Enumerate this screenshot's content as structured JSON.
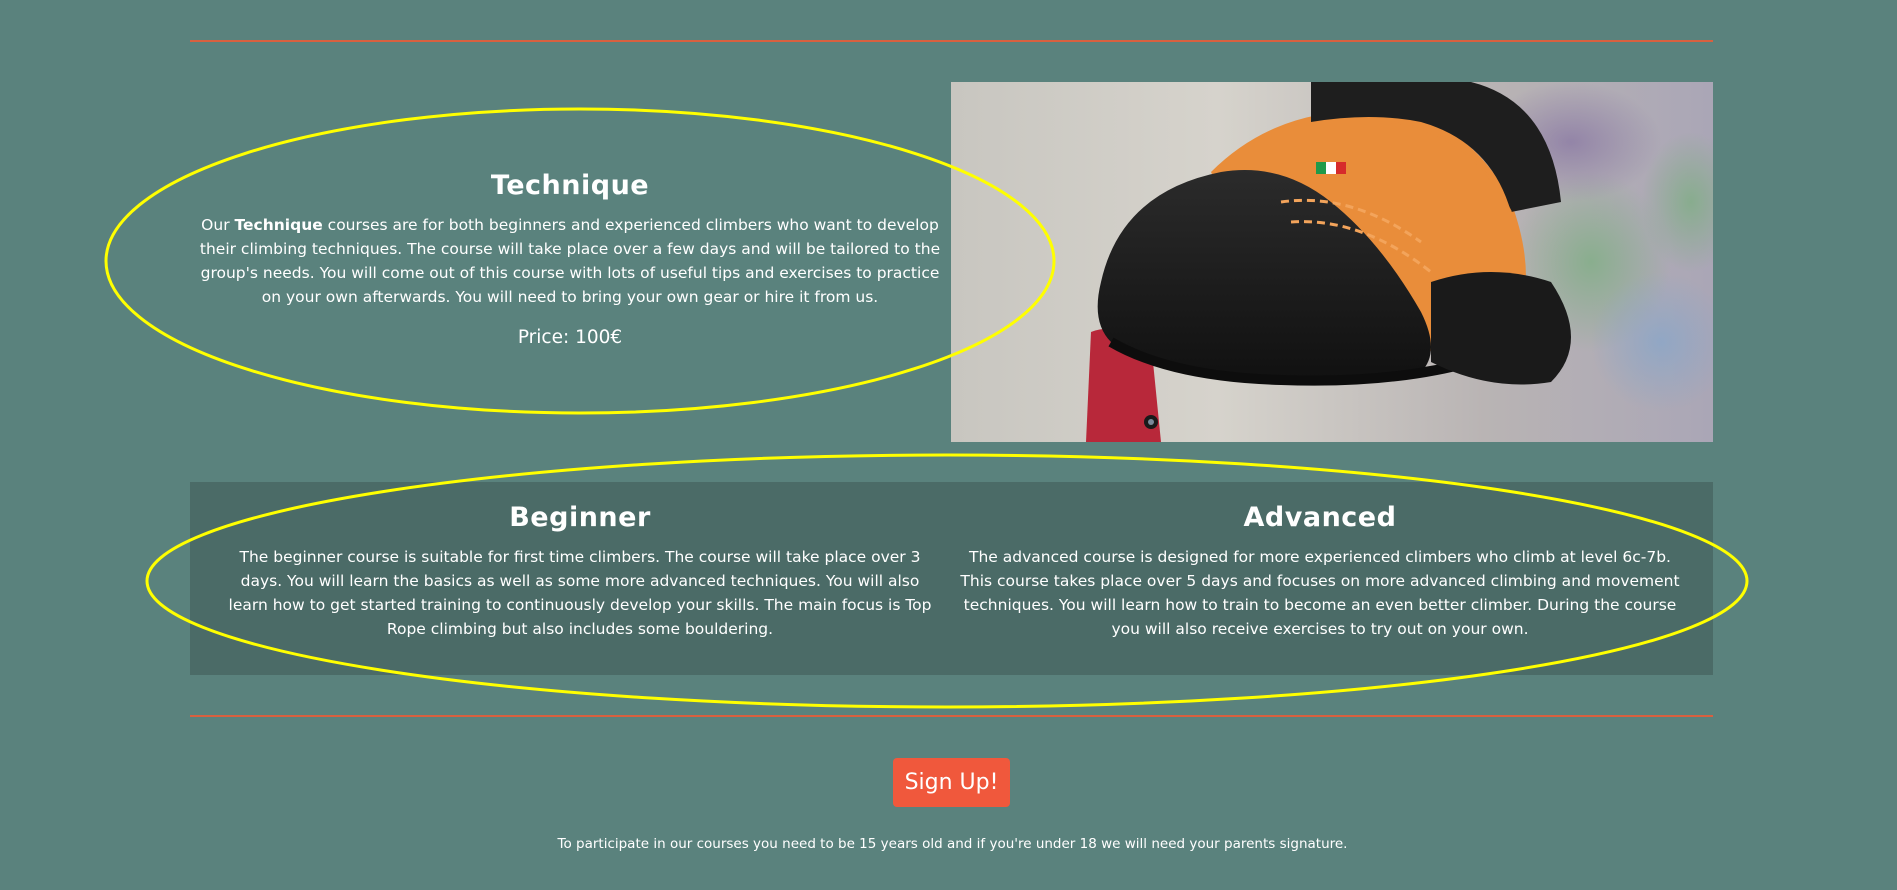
{
  "technique": {
    "title": "Technique",
    "description_prefix": "Our ",
    "description_bold": "Technique",
    "description_rest": " courses are for both beginners and experienced climbers who want to develop their climbing techniques. The course will take place over a few days and will be tailored to the group's needs. You will come out of this course with lots of useful tips and exercises to practice on your own afterwards. You will need to bring your own gear or hire it from us.",
    "price": "Price: 100€"
  },
  "photo": {
    "icon": "climbing-shoe-photo"
  },
  "levels": {
    "beginner": {
      "title": "Beginner",
      "description": "The beginner course is suitable for first time climbers. The course will take place over 3 days. You will learn the basics as well as some more advanced techniques. You will also learn how to get started training to continuously develop your skills. The main focus is Top Rope climbing but also includes some bouldering."
    },
    "advanced": {
      "title": "Advanced",
      "description": "The advanced course is designed for more experienced climbers who climb at level 6c-7b. This course takes place over 5 days and focuses on more advanced climbing and movement techniques. You will learn how to train to become an even better climber. During the course you will also receive exercises to try out on your own."
    }
  },
  "signup": {
    "label": "Sign Up!"
  },
  "footer": {
    "note": "To participate in our courses you need to be 15 years old and if you're under 18 we will need your parents signature."
  },
  "colors": {
    "background": "#5a827d",
    "panel": "#4b6b67",
    "accent": "#f0583c",
    "divider": "#d9603f",
    "highlight": "#ffff00"
  }
}
